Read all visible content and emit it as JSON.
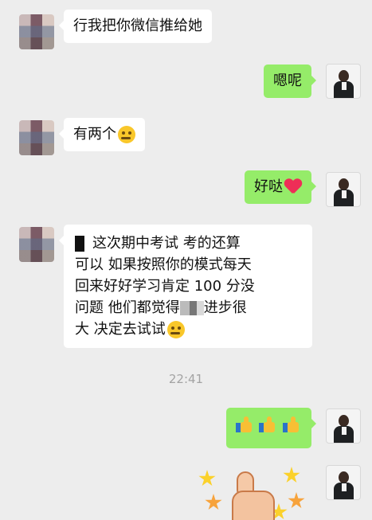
{
  "messages": [
    {
      "side": "left",
      "text": "行我把你微信推给她"
    },
    {
      "side": "right",
      "text": "嗯呢"
    },
    {
      "side": "left",
      "text": "有两个",
      "emoji": "thinking-face"
    },
    {
      "side": "right",
      "text": "好哒",
      "emoji": "red-heart"
    },
    {
      "side": "left",
      "lines": [
        "这次期中考试 考的还算",
        "可以 如果按照你的模式每天",
        "回来好好学习肯定 100 分没",
        "问题 他们都觉得",
        "进步很",
        "大 决定去试试"
      ],
      "emoji": "thinking-face"
    },
    {
      "side": "right",
      "emoji": "thumbs-up",
      "count": 3
    },
    {
      "side": "right",
      "sticker": "thumbs-up-stars"
    }
  ],
  "timestamp": "22:41",
  "colors": {
    "background": "#ededed",
    "bubble_self": "#95ec69",
    "bubble_other": "#ffffff"
  },
  "icons": {
    "heart": "red-heart-icon",
    "thinking": "thinking-face-icon",
    "thumbs": "thumbs-up-icon"
  }
}
